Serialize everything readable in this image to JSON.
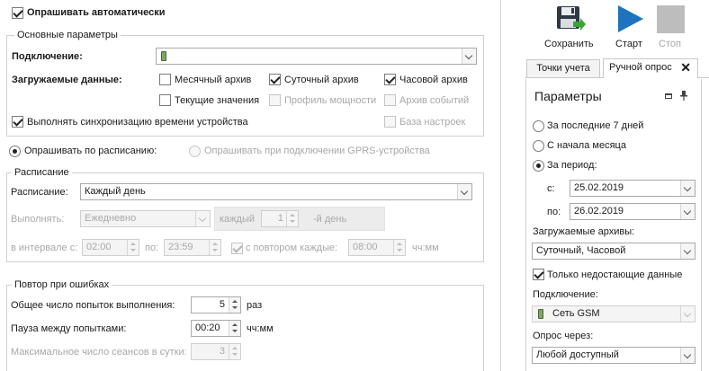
{
  "left": {
    "auto_poll": {
      "label": "Опрашивать автоматически",
      "checked": true
    },
    "main_params": {
      "title": "Основные параметры",
      "connection_label": "Подключение:",
      "connection_value": "",
      "loaded_data_label": "Загружаемые данные:",
      "items": [
        {
          "label": "Месячный архив",
          "checked": false,
          "enabled": true
        },
        {
          "label": "Суточный архив",
          "checked": true,
          "enabled": true
        },
        {
          "label": "Часовой архив",
          "checked": true,
          "enabled": true
        },
        {
          "label": "Текущие значения",
          "checked": false,
          "enabled": true
        },
        {
          "label": "Профиль мощности",
          "checked": false,
          "enabled": false
        },
        {
          "label": "Архив событий",
          "checked": false,
          "enabled": false
        },
        {
          "label": "База настроек",
          "checked": false,
          "enabled": false
        }
      ],
      "sync_time": {
        "label": "Выполнять синхронизацию времени устройства",
        "checked": true
      }
    },
    "poll_mode": {
      "schedule": {
        "label": "Опрашивать по расписанию:",
        "selected": true
      },
      "gprs": {
        "label": "Опрашивать при подключении GPRS-устройства",
        "selected": false
      }
    },
    "schedule": {
      "title": "Расписание",
      "schedule_label": "Расписание:",
      "schedule_value": "Каждый день",
      "execute_label": "Выполнять:",
      "execute_value": "Ежедневно",
      "every_label": "каждый",
      "every_value": "1",
      "day_suffix": "-й день",
      "interval_label": "в интервале с:",
      "from_value": "02:00",
      "to_label": "по:",
      "to_value": "23:59",
      "repeat": {
        "label": "с повтором каждые:",
        "checked": true,
        "value": "08:00"
      },
      "unit": "чч:мм"
    },
    "retry": {
      "title": "Повтор при ошибках",
      "total_label": "Общее число попыток выполнения:",
      "total_value": "5",
      "total_unit": "раз",
      "pause_label": "Пауза между попытками:",
      "pause_value": "00:20",
      "pause_unit": "чч:мм",
      "max_label": "Максимальное число сеансов в сутки:",
      "max_value": "3"
    }
  },
  "toolbar": {
    "save": "Сохранить",
    "start": "Старт",
    "stop": "Стоп"
  },
  "tabs": [
    {
      "label": "Точки учета",
      "active": false
    },
    {
      "label": "Ручной опрос",
      "active": true
    }
  ],
  "panel": {
    "title": "Параметры",
    "last7": {
      "label": "За последние 7 дней",
      "selected": false
    },
    "month_start": {
      "label": "С начала месяца",
      "selected": false
    },
    "period": {
      "label": "За период:",
      "selected": true
    },
    "from_label": "с:",
    "from_value": "25.02.2019",
    "to_label": "по:",
    "to_value": "26.02.2019",
    "archives_label": "Загружаемые архивы:",
    "archives_value": "Суточный, Часовой",
    "only_missing": {
      "label": "Только недостающие данные",
      "checked": true
    },
    "connection_label": "Подключение:",
    "connection_value": "Сеть GSM",
    "via_label": "Опрос через:",
    "via_value": "Любой доступный"
  },
  "colors": {
    "start_blue": "#1e73be",
    "save_green": "#3aa535",
    "stop_gray": "#bdbdbd"
  }
}
